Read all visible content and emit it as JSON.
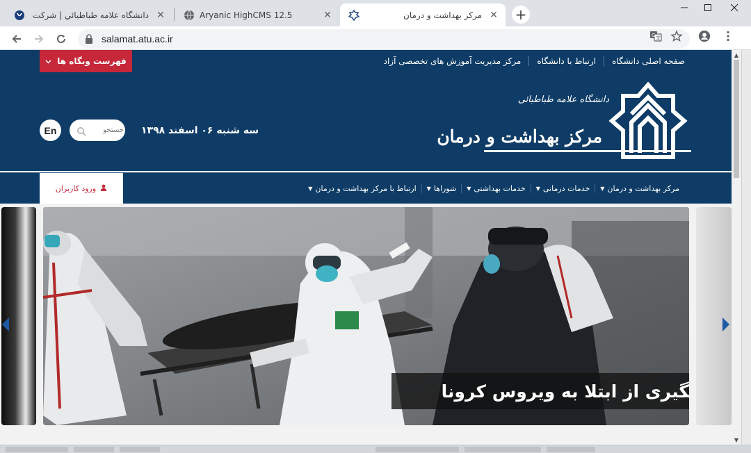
{
  "browser": {
    "tabs": [
      {
        "title": "دانشگاه علامه طباطبائي | شرکت سامانه سا"
      },
      {
        "title": "Aryanic HighCMS 12.5"
      },
      {
        "title": "مرکز بهداشت و درمان"
      }
    ],
    "url": "salamat.atu.ac.ir",
    "colors": {
      "chrome_frame": "#dee1e6",
      "omnibox": "#f1f3f4"
    }
  },
  "site": {
    "colors": {
      "primary": "#0e3c66",
      "accent": "#c6283a"
    },
    "topbar": {
      "links": [
        "صفحه اصلی دانشگاه",
        "ارتباط با دانشگاه",
        "مرکز مدیریت آموزش های تخصصی آزاد"
      ],
      "portals_button": "فهرست وبگاه ها"
    },
    "header": {
      "university_name": "دانشگاه علامه طباطبائی",
      "center_name": "مرکز بهداشت و درمان",
      "date": "سه شنبه ۰۶ اسفند ۱۳۹۸",
      "search_placeholder": "جستجو",
      "language_button": "En"
    },
    "nav": {
      "items": [
        "مرکز بهداشت و درمان",
        "خدمات درمانی",
        "خدمات بهداشتی",
        "شوراها",
        "ارتباط با مرکز بهداشت و درمان"
      ],
      "login_button": "ورود کاربران"
    },
    "slider": {
      "caption": "پیشگیری از ابتلا به ویروس کرونا"
    }
  }
}
